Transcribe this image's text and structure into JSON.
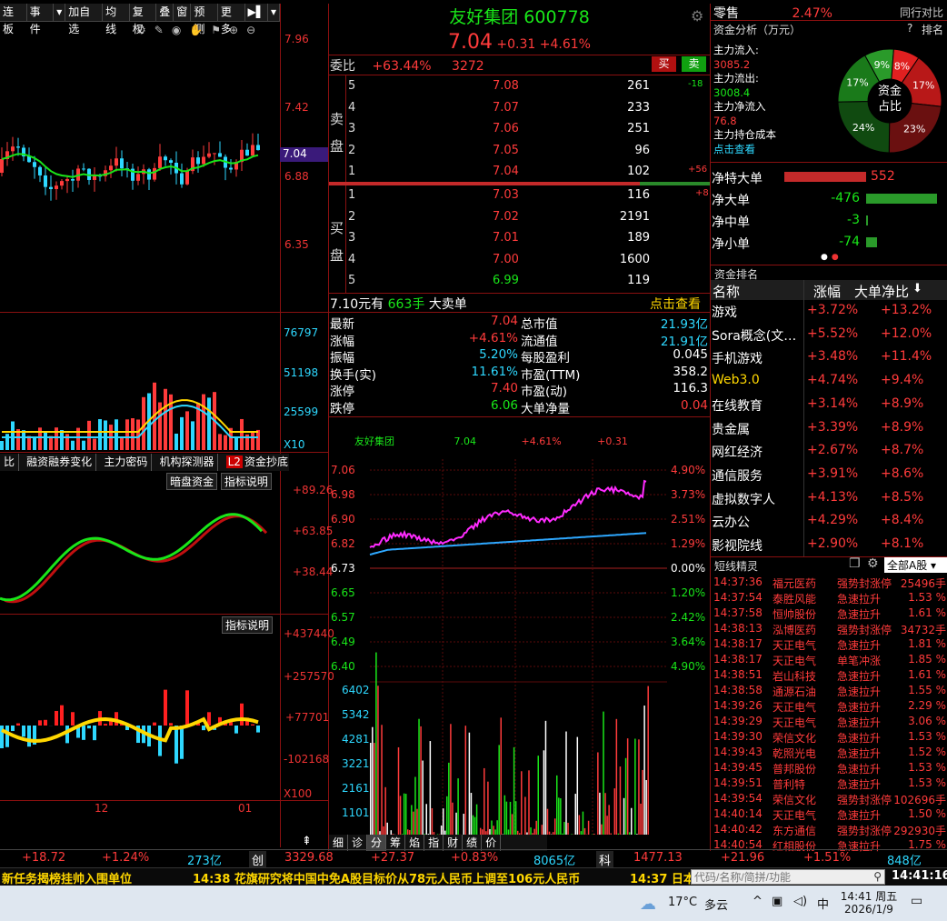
{
  "toolbar": {
    "items": [
      "连板",
      "事件",
      "加自选",
      "均线",
      "复权",
      "叠",
      "窗",
      "预测",
      "更多"
    ]
  },
  "kline": {
    "price_axis": [
      "7.96",
      "7.42",
      "6.88",
      "6.35"
    ],
    "current_tag": "7.04",
    "vol_axis": [
      "76797",
      "51198",
      "25599",
      "X10"
    ],
    "ind_tabs": [
      "融资融券变化",
      "主力密码",
      "机构探测器",
      "资金抄底"
    ],
    "ind_badge": "L2",
    "ind_btns": [
      "暗盘资金",
      "指标说明"
    ],
    "ind_axis": [
      "+89.26",
      "+63.85",
      "+38.44"
    ],
    "ind2_btn": "指标说明",
    "ind2_axis": [
      "+437440",
      "+257570",
      "+77701",
      "-102168",
      "X100"
    ],
    "date_labels": [
      "12",
      "01"
    ]
  },
  "header": {
    "name": "友好集团",
    "code": "600778",
    "price": "7.04",
    "change": "+0.31",
    "pct": "+4.61%"
  },
  "order": {
    "ratio_label": "委比",
    "ratio": "+63.44%",
    "diff": "3272",
    "buy_btn": "买",
    "sell_btn": "卖",
    "sell_label": [
      "卖",
      "盘"
    ],
    "buy_label": [
      "买",
      "盘"
    ],
    "asks": [
      [
        "5",
        "7.08",
        "261",
        "-18"
      ],
      [
        "4",
        "7.07",
        "233",
        ""
      ],
      [
        "3",
        "7.06",
        "251",
        ""
      ],
      [
        "2",
        "7.05",
        "96",
        ""
      ],
      [
        "1",
        "7.04",
        "102",
        "+56"
      ]
    ],
    "bids": [
      [
        "1",
        "7.03",
        "116",
        "+8"
      ],
      [
        "2",
        "7.02",
        "2191",
        ""
      ],
      [
        "3",
        "7.01",
        "189",
        ""
      ],
      [
        "4",
        "7.00",
        "1600",
        ""
      ],
      [
        "5",
        "6.99",
        "119",
        ""
      ]
    ],
    "big_order": "7.10元有",
    "big_hands": "663手",
    "big_label": "大卖单",
    "click_view": "点击查看"
  },
  "stats": [
    [
      "最新",
      "7.04",
      "总市值",
      "21.93亿"
    ],
    [
      "涨幅",
      "+4.61%",
      "流通值",
      "21.91亿"
    ],
    [
      "振幅",
      "5.20%",
      "每股盈利",
      "0.045"
    ],
    [
      "换手(实)",
      "11.61%",
      "市盈(TTM)",
      "358.2"
    ],
    [
      "涨停",
      "7.40",
      "市盈(动)",
      "116.3"
    ],
    [
      "跌停",
      "6.06",
      "大单净量",
      "0.04"
    ]
  ],
  "intraday": {
    "name": "友好集团",
    "price": "7.04",
    "pct": "+4.61%",
    "chg": "+0.31",
    "left_axis": [
      "7.06",
      "6.98",
      "6.90",
      "6.82",
      "6.73",
      "6.65",
      "6.57",
      "6.49",
      "6.40"
    ],
    "right_axis": [
      "4.90%",
      "3.73%",
      "2.51%",
      "1.29%",
      "0.00%",
      "1.20%",
      "2.42%",
      "3.64%",
      "4.90%"
    ],
    "vol_axis": [
      "6402",
      "5342",
      "4281",
      "3221",
      "2161",
      "1101"
    ],
    "tabs": [
      "细",
      "诊",
      "分",
      "筹",
      "焰",
      "指",
      "财",
      "绩",
      "价"
    ]
  },
  "fund": {
    "title": "零售",
    "title_pct": "2.47%",
    "compare": "同行对比",
    "analysis": "资金分析（万元）",
    "help": "?",
    "rank": "排名",
    "inflow_label": "主力流入:",
    "inflow": "3085.2",
    "outflow_label": "主力流出:",
    "outflow": "3008.4",
    "net_label": "主力净流入",
    "net": "76.8",
    "cost_label": "主力持仓成本",
    "cost_link": "点击查看",
    "pie_center": [
      "资金",
      "占比"
    ],
    "pie": [
      [
        "9%",
        9,
        "#2a9a2a"
      ],
      [
        "8%",
        8,
        "#e02020"
      ],
      [
        "17%",
        17,
        "#b81818"
      ],
      [
        "23%",
        23,
        "#6a1010"
      ],
      [
        "24%",
        24,
        "#104a10"
      ],
      [
        "17%",
        17,
        "#1a7a1a"
      ]
    ],
    "flows": [
      [
        "净特大单",
        "552",
        552
      ],
      [
        "净大单",
        "-476",
        -476
      ],
      [
        "净中单",
        "-3",
        -3
      ],
      [
        "净小单",
        "-74",
        -74
      ]
    ]
  },
  "ranking": {
    "title": "资金排名",
    "headers": [
      "名称",
      "涨幅",
      "大单净比"
    ],
    "rows": [
      [
        "游戏",
        "+3.72%",
        "+13.2%"
      ],
      [
        "Sora概念(文…",
        "+5.52%",
        "+12.0%"
      ],
      [
        "手机游戏",
        "+3.48%",
        "+11.4%"
      ],
      [
        "Web3.0",
        "+4.74%",
        "+9.4%"
      ],
      [
        "在线教育",
        "+3.14%",
        "+8.9%"
      ],
      [
        "贵金属",
        "+3.39%",
        "+8.9%"
      ],
      [
        "网红经济",
        "+2.67%",
        "+8.7%"
      ],
      [
        "通信服务",
        "+3.91%",
        "+8.6%"
      ],
      [
        "虚拟数字人",
        "+4.13%",
        "+8.5%"
      ],
      [
        "云办公",
        "+4.29%",
        "+8.4%"
      ],
      [
        "影视院线",
        "+2.90%",
        "+8.1%"
      ]
    ]
  },
  "short": {
    "title": "短线精灵",
    "filter": "全部A股",
    "rows": [
      [
        "14:37:36",
        "福元医药",
        "强势封涨停",
        "25496手"
      ],
      [
        "14:37:54",
        "泰胜风能",
        "急速拉升",
        "1.53 %"
      ],
      [
        "14:37:58",
        "恒帅股份",
        "急速拉升",
        "1.61 %"
      ],
      [
        "14:38:13",
        "泓博医药",
        "强势封涨停",
        "34732手"
      ],
      [
        "14:38:17",
        "天正电气",
        "急速拉升",
        "1.81 %"
      ],
      [
        "14:38:17",
        "天正电气",
        "单笔冲涨",
        "1.85 %"
      ],
      [
        "14:38:51",
        "岩山科技",
        "急速拉升",
        "1.61 %"
      ],
      [
        "14:38:58",
        "通源石油",
        "急速拉升",
        "1.55 %"
      ],
      [
        "14:39:26",
        "天正电气",
        "急速拉升",
        "2.29 %"
      ],
      [
        "14:39:29",
        "天正电气",
        "急速拉升",
        "3.06 %"
      ],
      [
        "14:39:30",
        "荣信文化",
        "急速拉升",
        "1.53 %"
      ],
      [
        "14:39:43",
        "乾照光电",
        "急速拉升",
        "1.52 %"
      ],
      [
        "14:39:45",
        "普邦股份",
        "急速拉升",
        "1.53 %"
      ],
      [
        "14:39:51",
        "普利特",
        "急速拉升",
        "1.53 %"
      ],
      [
        "14:39:54",
        "荣信文化",
        "强势封涨停",
        "102696手"
      ],
      [
        "14:40:14",
        "天正电气",
        "急速拉升",
        "1.50 %"
      ],
      [
        "14:40:42",
        "东方通信",
        "强势封涨停",
        "292930手"
      ],
      [
        "14:40:54",
        "红相股份",
        "急速拉升",
        "1.75 %"
      ]
    ]
  },
  "bottom": {
    "seg1": [
      "+18.72",
      "+1.24%",
      "273亿"
    ],
    "chuang": "创",
    "seg2": [
      "3329.68",
      "+27.37",
      "+0.83%",
      "8065亿"
    ],
    "ke": "科",
    "seg3": [
      "1477.13",
      "+21.96",
      "+1.51%",
      "848亿"
    ]
  },
  "news": {
    "items": [
      "新任务揭榜挂帅入围单位",
      "14:38 花旗研究将中国中免A股目标价从78元人民币上调至106元人民币",
      "14:37 日本"
    ],
    "search_placeholder": "代码/名称/简拼/功能",
    "clock": "14:41:16"
  },
  "taskbar": {
    "temp": "17°C",
    "weather": "多云",
    "ime": "中",
    "time": "14:41 周五",
    "date": "2026/1/9"
  },
  "colors": {
    "up": "#ff3b3b",
    "down": "#19e619",
    "panel_line": "#8a1010",
    "cyan": "#2ed8ff",
    "magenta": "#ff2bff",
    "yellow": "#ffd700"
  }
}
